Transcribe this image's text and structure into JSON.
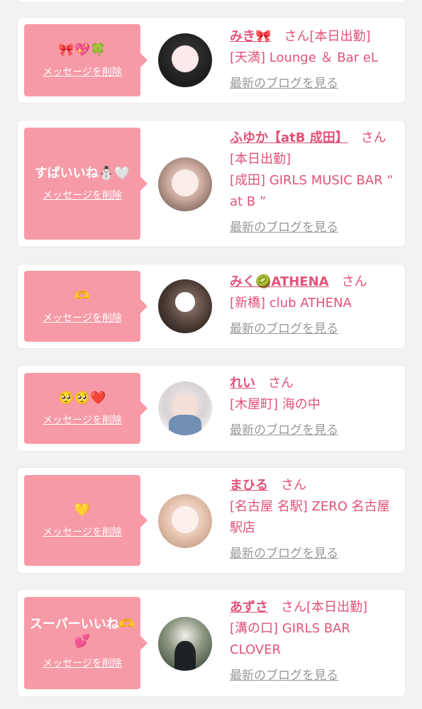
{
  "items": [
    {
      "message": "🎀💖🍀",
      "delete_label": "メッセージを削除",
      "name": "みき🎀",
      "suffix": "さん",
      "status": "[本日出勤]",
      "location": "[天満] Lounge ＆ Bar eL",
      "blog_label": "最新のブログを見る"
    },
    {
      "message": "すぱいいね⛄🤍",
      "delete_label": "メッセージを削除",
      "name": "ふゆか【atB 成田】",
      "suffix": "さん",
      "status": "[本日出勤]",
      "location": "[成田] GIRLS MUSIC BAR “ at B ”",
      "blog_label": "最新のブログを見る"
    },
    {
      "message": "🫶",
      "delete_label": "メッセージを削除",
      "name": "みく🥝ATHENA",
      "suffix": "さん",
      "status": "",
      "location": "[新橋] club ATHENA",
      "blog_label": "最新のブログを見る"
    },
    {
      "message": "🥺🥺❤️",
      "delete_label": "メッセージを削除",
      "name": "れい",
      "suffix": "さん",
      "status": "",
      "location": "[木屋町] 海の中",
      "blog_label": "最新のブログを見る"
    },
    {
      "message": "💛",
      "delete_label": "メッセージを削除",
      "name": "まひる",
      "suffix": "さん",
      "status": "",
      "location": "[名古屋 名駅] ZERO 名古屋駅店",
      "blog_label": "最新のブログを見る"
    },
    {
      "message": "スーパーいいね🫶\n💕",
      "delete_label": "メッセージを削除",
      "name": "あずさ",
      "suffix": "さん",
      "status": "[本日出勤]",
      "location": "[溝の口] GIRLS BAR CLOVER",
      "blog_label": "最新のブログを見る"
    }
  ],
  "colors": {
    "accent": "#e25277",
    "bubble": "#f79aa7",
    "link_gray": "#999999"
  }
}
